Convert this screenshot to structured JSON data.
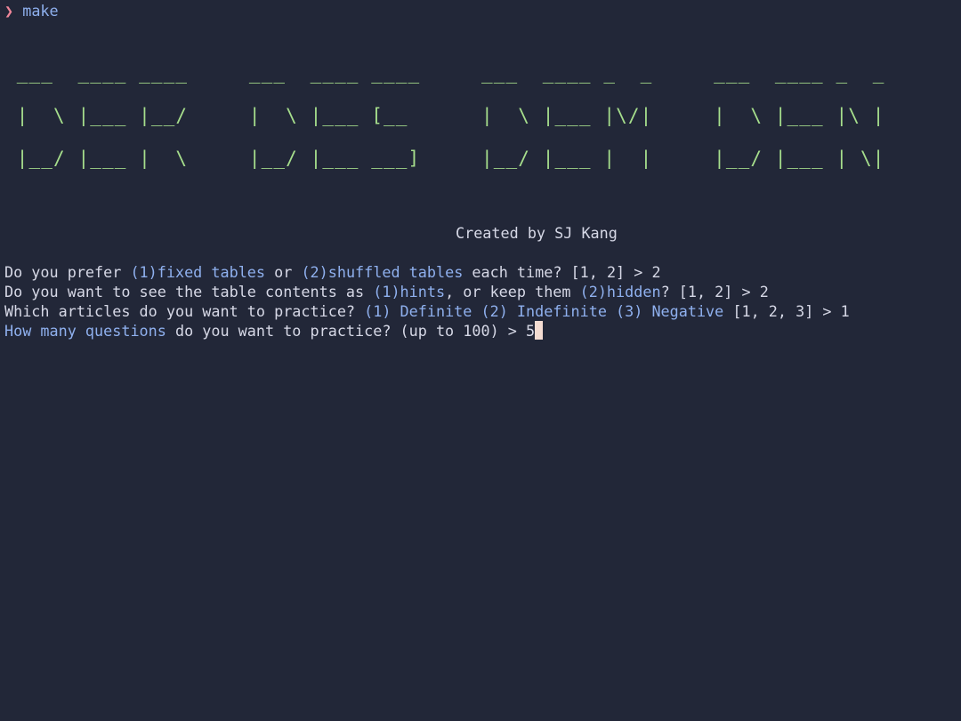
{
  "prompt": {
    "symbol": "❯",
    "command": "make"
  },
  "banner": {
    "ascii_lines": [
      " ___  ____ ____     ___  ____ ____     ___  ____ _  _     ___  ____ _  _ ",
      " |  \\ |___ |__/     |  \\ |___ [__      |  \\ |___ |\\/|     |  \\ |___ |\\ | ",
      " |__/ |___ |  \\     |__/ |___ ___]     |__/ |___ |  |     |__/ |___ | \\| "
    ],
    "credit": "Created by SJ Kang"
  },
  "questions": [
    {
      "parts": [
        {
          "text": "Do you prefer ",
          "style": "plain"
        },
        {
          "text": "(1)fixed tables",
          "style": "hl"
        },
        {
          "text": " or ",
          "style": "plain"
        },
        {
          "text": "(2)shuffled tables",
          "style": "hl"
        },
        {
          "text": " each time? [1, 2] > 2",
          "style": "plain"
        }
      ]
    },
    {
      "parts": [
        {
          "text": "Do you want to see the table contents as ",
          "style": "plain"
        },
        {
          "text": "(1)hints",
          "style": "hl"
        },
        {
          "text": ", or keep them ",
          "style": "plain"
        },
        {
          "text": "(2)hidden",
          "style": "hl"
        },
        {
          "text": "? [1, 2] > 2",
          "style": "plain"
        }
      ]
    },
    {
      "parts": [
        {
          "text": "Which articles do you want to practice? ",
          "style": "plain"
        },
        {
          "text": "(1) Definite (2) Indefinite (3) Negative",
          "style": "hl"
        },
        {
          "text": " [1, 2, 3] > 1",
          "style": "plain"
        }
      ]
    },
    {
      "parts": [
        {
          "text": "How many questions",
          "style": "hl"
        },
        {
          "text": " do you want to practice? (up to 100) > 5",
          "style": "plain"
        }
      ]
    }
  ],
  "colors": {
    "background": "#222738",
    "text": "#d6d8e6",
    "highlight": "#8fb0ee",
    "ascii_art": "#a6de8c",
    "prompt_symbol": "#f0879a",
    "cursor": "#f4dcd2"
  }
}
